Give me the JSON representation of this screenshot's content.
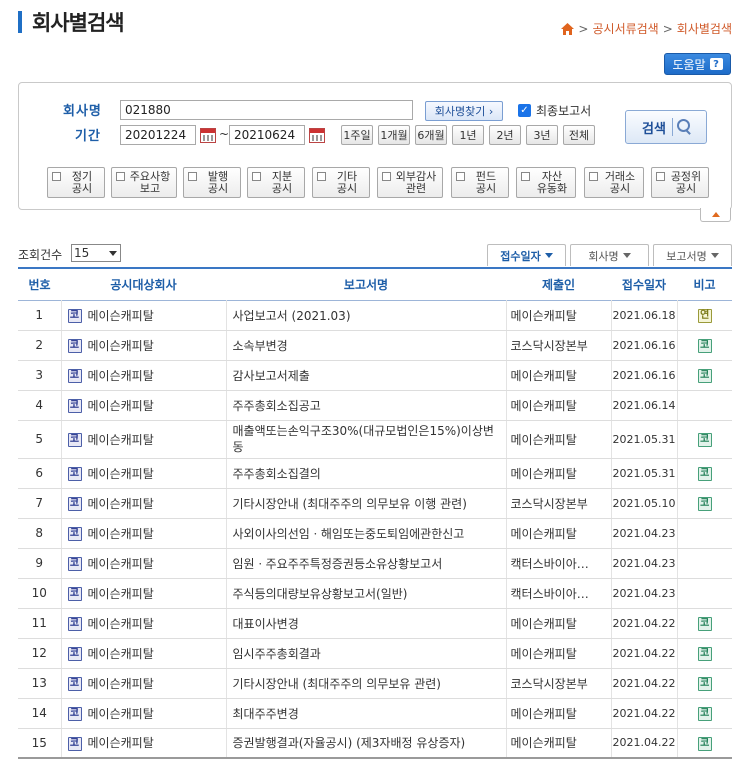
{
  "page": {
    "title": "회사별검색"
  },
  "breadcrumb": {
    "items": [
      "공시서류검색",
      "회사별검색"
    ]
  },
  "help": {
    "label": "도움말"
  },
  "search": {
    "company_label": "회사명",
    "company_value": "021880",
    "find_company_label": "회사명찾기 ›",
    "final_report_label": "최종보고서",
    "final_report_checked": true,
    "period_label": "기간",
    "start_date": "20201224",
    "end_date": "20210624",
    "date_sep": "~",
    "periods": [
      "1주일",
      "1개월",
      "6개월",
      "1년",
      "2년",
      "3년",
      "전체"
    ],
    "search_label": "검색",
    "types": [
      "정기\n공시",
      "주요사항\n보고",
      "발행\n공시",
      "지분\n공시",
      "기타\n공시",
      "외부감사\n관련",
      "펀드\n공시",
      "자산\n유동화",
      "거래소\n공시",
      "공정위\n공시"
    ]
  },
  "list": {
    "count_label": "조회건수",
    "count_value": "15",
    "sorts": [
      "접수일자",
      "회사명",
      "보고서명"
    ],
    "columns": [
      "번호",
      "공시대상회사",
      "보고서명",
      "제출인",
      "접수일자",
      "비고"
    ],
    "company_mark": "코",
    "rows": [
      {
        "no": "1",
        "company": "메이슨캐피탈",
        "report": "사업보고서 (2021.03)",
        "submitter": "메이슨캐피탈",
        "date": "2021.06.18",
        "note": "연"
      },
      {
        "no": "2",
        "company": "메이슨캐피탈",
        "report": "소속부변경",
        "submitter": "코스닥시장본부",
        "date": "2021.06.16",
        "note": "코"
      },
      {
        "no": "3",
        "company": "메이슨캐피탈",
        "report": "감사보고서제출",
        "submitter": "메이슨캐피탈",
        "date": "2021.06.16",
        "note": "코"
      },
      {
        "no": "4",
        "company": "메이슨캐피탈",
        "report": "주주총회소집공고",
        "submitter": "메이슨캐피탈",
        "date": "2021.06.14",
        "note": ""
      },
      {
        "no": "5",
        "company": "메이슨캐피탈",
        "report": "매출액또는손익구조30%(대규모법인은15%)이상변동",
        "submitter": "메이슨캐피탈",
        "date": "2021.05.31",
        "note": "코"
      },
      {
        "no": "6",
        "company": "메이슨캐피탈",
        "report": "주주총회소집결의",
        "submitter": "메이슨캐피탈",
        "date": "2021.05.31",
        "note": "코"
      },
      {
        "no": "7",
        "company": "메이슨캐피탈",
        "report": "기타시장안내 (최대주주의 의무보유 이행 관련)",
        "submitter": "코스닥시장본부",
        "date": "2021.05.10",
        "note": "코"
      },
      {
        "no": "8",
        "company": "메이슨캐피탈",
        "report": "사외이사의선임ㆍ해임또는중도퇴임에관한신고",
        "submitter": "메이슨캐피탈",
        "date": "2021.04.23",
        "note": ""
      },
      {
        "no": "9",
        "company": "메이슨캐피탈",
        "report": "임원ㆍ주요주주특정증권등소유상황보고서",
        "submitter": "캑터스바이아…",
        "date": "2021.04.23",
        "note": ""
      },
      {
        "no": "10",
        "company": "메이슨캐피탈",
        "report": "주식등의대량보유상황보고서(일반)",
        "submitter": "캑터스바이아…",
        "date": "2021.04.23",
        "note": ""
      },
      {
        "no": "11",
        "company": "메이슨캐피탈",
        "report": "대표이사변경",
        "submitter": "메이슨캐피탈",
        "date": "2021.04.22",
        "note": "코"
      },
      {
        "no": "12",
        "company": "메이슨캐피탈",
        "report": "임시주주총회결과",
        "submitter": "메이슨캐피탈",
        "date": "2021.04.22",
        "note": "코"
      },
      {
        "no": "13",
        "company": "메이슨캐피탈",
        "report": "기타시장안내 (최대주주의 의무보유 관련)",
        "submitter": "코스닥시장본부",
        "date": "2021.04.22",
        "note": "코"
      },
      {
        "no": "14",
        "company": "메이슨캐피탈",
        "report": "최대주주변경",
        "submitter": "메이슨캐피탈",
        "date": "2021.04.22",
        "note": "코"
      },
      {
        "no": "15",
        "company": "메이슨캐피탈",
        "report": "증권발행결과(자율공시) (제3자배정 유상증자)",
        "submitter": "메이슨캐피탈",
        "date": "2021.04.22",
        "note": "코"
      }
    ]
  }
}
